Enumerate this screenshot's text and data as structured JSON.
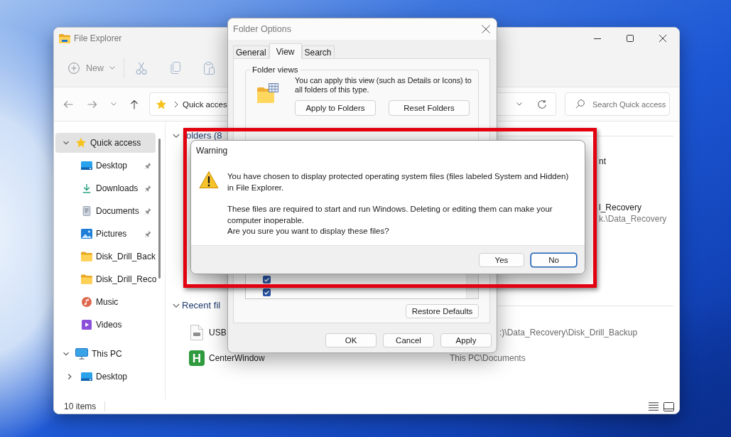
{
  "explorer": {
    "title": "File Explorer",
    "toolbar": {
      "new_button": "New"
    },
    "address": {
      "path": "Quick acces"
    },
    "search": {
      "placeholder": "Search Quick access"
    },
    "sidebar": {
      "items": [
        {
          "label": "Quick access",
          "kind": "star",
          "expanded": true,
          "selected": true,
          "children": [
            {
              "label": "Desktop",
              "kind": "desktop",
              "pinned": true,
              "selected": false
            },
            {
              "label": "Downloads",
              "kind": "downloads",
              "pinned": true,
              "selected": false
            },
            {
              "label": "Documents",
              "kind": "documents",
              "pinned": true,
              "selected": false
            },
            {
              "label": "Pictures",
              "kind": "pictures",
              "pinned": true,
              "selected": false
            },
            {
              "label": "Disk_Drill_Back",
              "kind": "folder",
              "pinned": false,
              "selected": false
            },
            {
              "label": "Disk_Drill_Reco",
              "kind": "folder",
              "pinned": false,
              "selected": false
            },
            {
              "label": "Music",
              "kind": "music",
              "pinned": false,
              "selected": false
            },
            {
              "label": "Videos",
              "kind": "videos",
              "pinned": false,
              "selected": false
            }
          ]
        },
        {
          "label": "This PC",
          "kind": "pc",
          "expanded": true,
          "selected": false,
          "children": [
            {
              "label": "Desktop",
              "kind": "desktop",
              "expanded": false,
              "selected": false
            }
          ]
        }
      ]
    },
    "content": {
      "sections": [
        {
          "title": "olders (8",
          "kind": "folders",
          "expanded": true,
          "items": [
            {
              "name": "nt"
            },
            {
              "name": "l_Recovery",
              "path": "k.\\Data_Recovery"
            }
          ]
        },
        {
          "title": "Recent fil",
          "kind": "recent",
          "expanded": true,
          "items": [
            {
              "name": "USB",
              "kind": "file",
              "location": ":)\\Data_Recovery\\Disk_Drill_Backup"
            },
            {
              "name": "CenterWindow",
              "kind": "app",
              "badge": "H",
              "location": "This PC\\Documents"
            }
          ]
        }
      ]
    },
    "status_bar": {
      "count": "10 items"
    }
  },
  "folder_options": {
    "title": "Folder Options",
    "tabs": [
      {
        "label": "General",
        "selected": false
      },
      {
        "label": "View",
        "selected": true
      },
      {
        "label": "Search",
        "selected": false
      }
    ],
    "folder_views": {
      "legend": "Folder views",
      "description": "You can apply this view (such as Details or Icons) to all folders of this type.",
      "buttons": [
        "Apply to Folders",
        "Reset Folders"
      ]
    },
    "advanced_settings": [
      {
        "checked": true
      },
      {
        "checked": true
      }
    ],
    "restore_button": "Restore Defaults",
    "buttons": [
      "OK",
      "Cancel",
      "Apply"
    ]
  },
  "warning": {
    "title": "Warning",
    "paragraphs": [
      [
        "You have chosen to display protected operating system files (files labeled System and Hidden) in File Explorer."
      ],
      [
        "These files are required to start and run Windows. Deleting or editing them can make your computer inoperable.",
        "Are you sure you want to display these files?"
      ]
    ],
    "buttons": [
      {
        "label": "Yes",
        "focused": false
      },
      {
        "label": "No",
        "focused": true
      }
    ]
  }
}
